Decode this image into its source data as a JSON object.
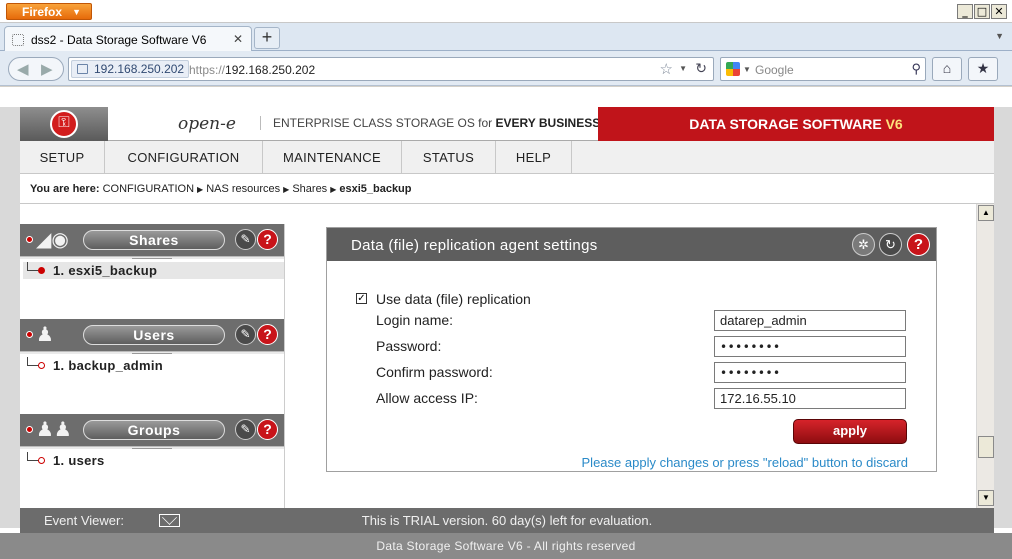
{
  "browser": {
    "app_button": "Firefox",
    "window_buttons": [
      "_",
      "□",
      "✕"
    ],
    "tab_title": "dss2 - Data Storage Software V6",
    "identity": "192.168.250.202",
    "url_scheme": "https://",
    "url_host": "192.168.250.202",
    "search_placeholder": "Google"
  },
  "header": {
    "brand": "open-e",
    "tagline_pre": "ENTERPRISE CLASS STORAGE OS for ",
    "tagline_bold": "EVERY BUSINESS",
    "product": "DATA STORAGE SOFTWARE ",
    "version": "V6"
  },
  "menu": [
    "SETUP",
    "CONFIGURATION",
    "MAINTENANCE",
    "STATUS",
    "HELP"
  ],
  "breadcrumb": {
    "label": "You are here:",
    "items": [
      "CONFIGURATION",
      "NAS resources",
      "Shares"
    ],
    "current": "esxi5_backup"
  },
  "sidebar": {
    "sections": [
      {
        "title": "Shares",
        "items": [
          "1. esxi5_backup"
        ]
      },
      {
        "title": "Users",
        "items": [
          "1. backup_admin"
        ]
      },
      {
        "title": "Groups",
        "items": [
          "1. users"
        ]
      }
    ]
  },
  "panel": {
    "title": "Data (file) replication agent settings",
    "checkbox_label": "Use data (file) replication",
    "checkbox_checked": true,
    "fields": [
      {
        "label": "Login name:",
        "value": "datarep_admin"
      },
      {
        "label": "Password:",
        "value": "••••••••"
      },
      {
        "label": "Confirm password:",
        "value": "••••••••"
      },
      {
        "label": "Allow access IP:",
        "value": "172.16.55.10"
      }
    ],
    "apply_label": "apply",
    "note": "Please apply changes or press \"reload\" button to discard"
  },
  "footer": {
    "event_viewer": "Event Viewer:",
    "trial": "This is TRIAL version. 60 day(s) left for evaluation.",
    "copyright": "Data Storage Software V6 - All rights reserved"
  },
  "colors": {
    "brand_red": "#c0141a",
    "link_blue": "#2a8ac8",
    "header_gray": "#5e5e5e"
  }
}
